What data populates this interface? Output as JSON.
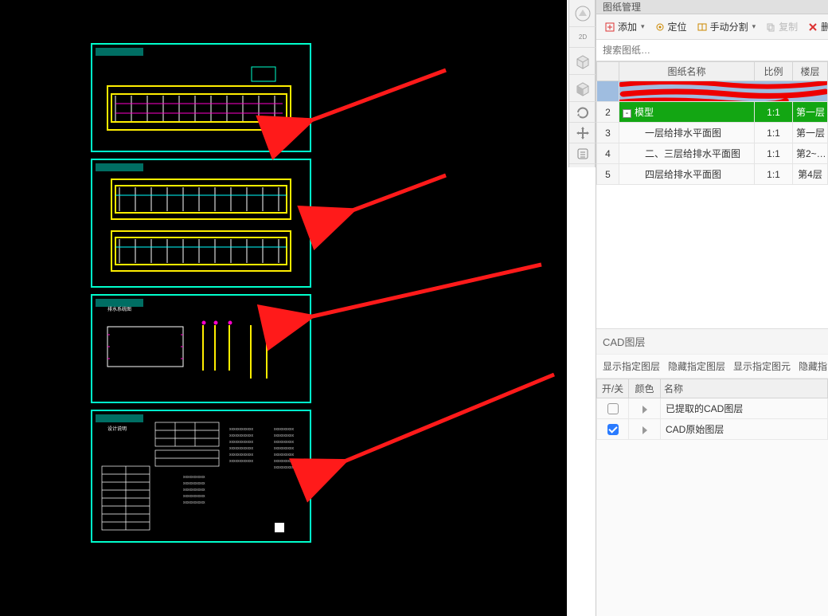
{
  "panels": {
    "drawings_title": "图纸管理",
    "layers_title": "CAD图层"
  },
  "toolbar": {
    "add": "添加",
    "locate": "定位",
    "manual_split": "手动分割",
    "copy": "复制",
    "delete": "删"
  },
  "search": {
    "placeholder": "搜索图纸…"
  },
  "columns": {
    "name": "图纸名称",
    "ratio": "比例",
    "floor": "楼层"
  },
  "rows": {
    "hdr": {
      "idx": "",
      "redacted": true
    },
    "r2": {
      "idx": "2",
      "name": "模型",
      "ratio": "1:1",
      "floor": "第一层",
      "toggle": "-"
    },
    "r3": {
      "idx": "3",
      "name": "一层给排水平面图",
      "ratio": "1:1",
      "floor": "第一层"
    },
    "r4": {
      "idx": "4",
      "name": "二、三层给排水平面图",
      "ratio": "1:1",
      "floor": "第2~…"
    },
    "r5": {
      "idx": "5",
      "name": "四层给排水平面图",
      "ratio": "1:1",
      "floor": "第4层"
    }
  },
  "layerBtns": {
    "showLayer": "显示指定图层",
    "hideLayer": "隐藏指定图层",
    "showEntity": "显示指定图元",
    "hideEntity": "隐藏指"
  },
  "layerCols": {
    "on": "开/关",
    "color": "颜色",
    "name": "名称"
  },
  "layers": {
    "l1": {
      "on": false,
      "name": "已提取的CAD图层"
    },
    "l2": {
      "on": true,
      "name": "CAD原始图层"
    }
  },
  "iconColors": {
    "add": "#d33",
    "locate": "#c80",
    "split": "#c80",
    "copy": "#bbb",
    "del": "#d33"
  }
}
